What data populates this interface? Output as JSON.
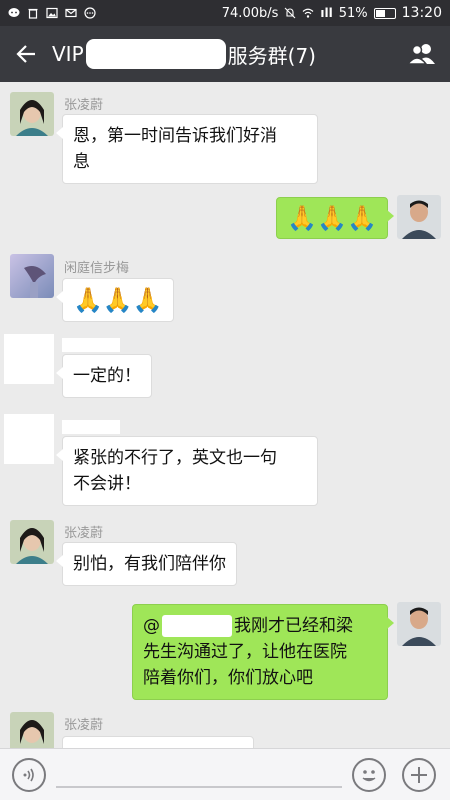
{
  "status_bar": {
    "speed": "74.00b/s",
    "signal": "ıll",
    "battery": "51%",
    "battery_level": 0.51,
    "time": "13:20"
  },
  "header": {
    "title_prefix": "VIP",
    "title_suffix": "服务群(7)"
  },
  "messages": [
    {
      "side": "in",
      "sender": "张凌蔚",
      "line1": "恩，第一时间告诉我们好消",
      "line2": "息"
    },
    {
      "side": "out",
      "text": "🙏🙏🙏"
    },
    {
      "side": "in",
      "sender": "闲庭信步梅",
      "text": "🙏🙏🙏"
    },
    {
      "side": "in",
      "sender": "",
      "text": "一定的！"
    },
    {
      "side": "in",
      "sender": "",
      "line1": "紧张的不行了，英文也一句",
      "line2": "不会讲！"
    },
    {
      "side": "in",
      "sender": "张凌蔚",
      "text": "别怕，有我们陪伴你"
    },
    {
      "side": "out",
      "prefix": "@",
      "rest1": "我刚才已经和梁",
      "line2": "先生沟通过了，让他在医院",
      "line3": "陪着你们，你们放心吧"
    },
    {
      "side": "in",
      "sender": "张凌蔚",
      "text": ""
    }
  ]
}
